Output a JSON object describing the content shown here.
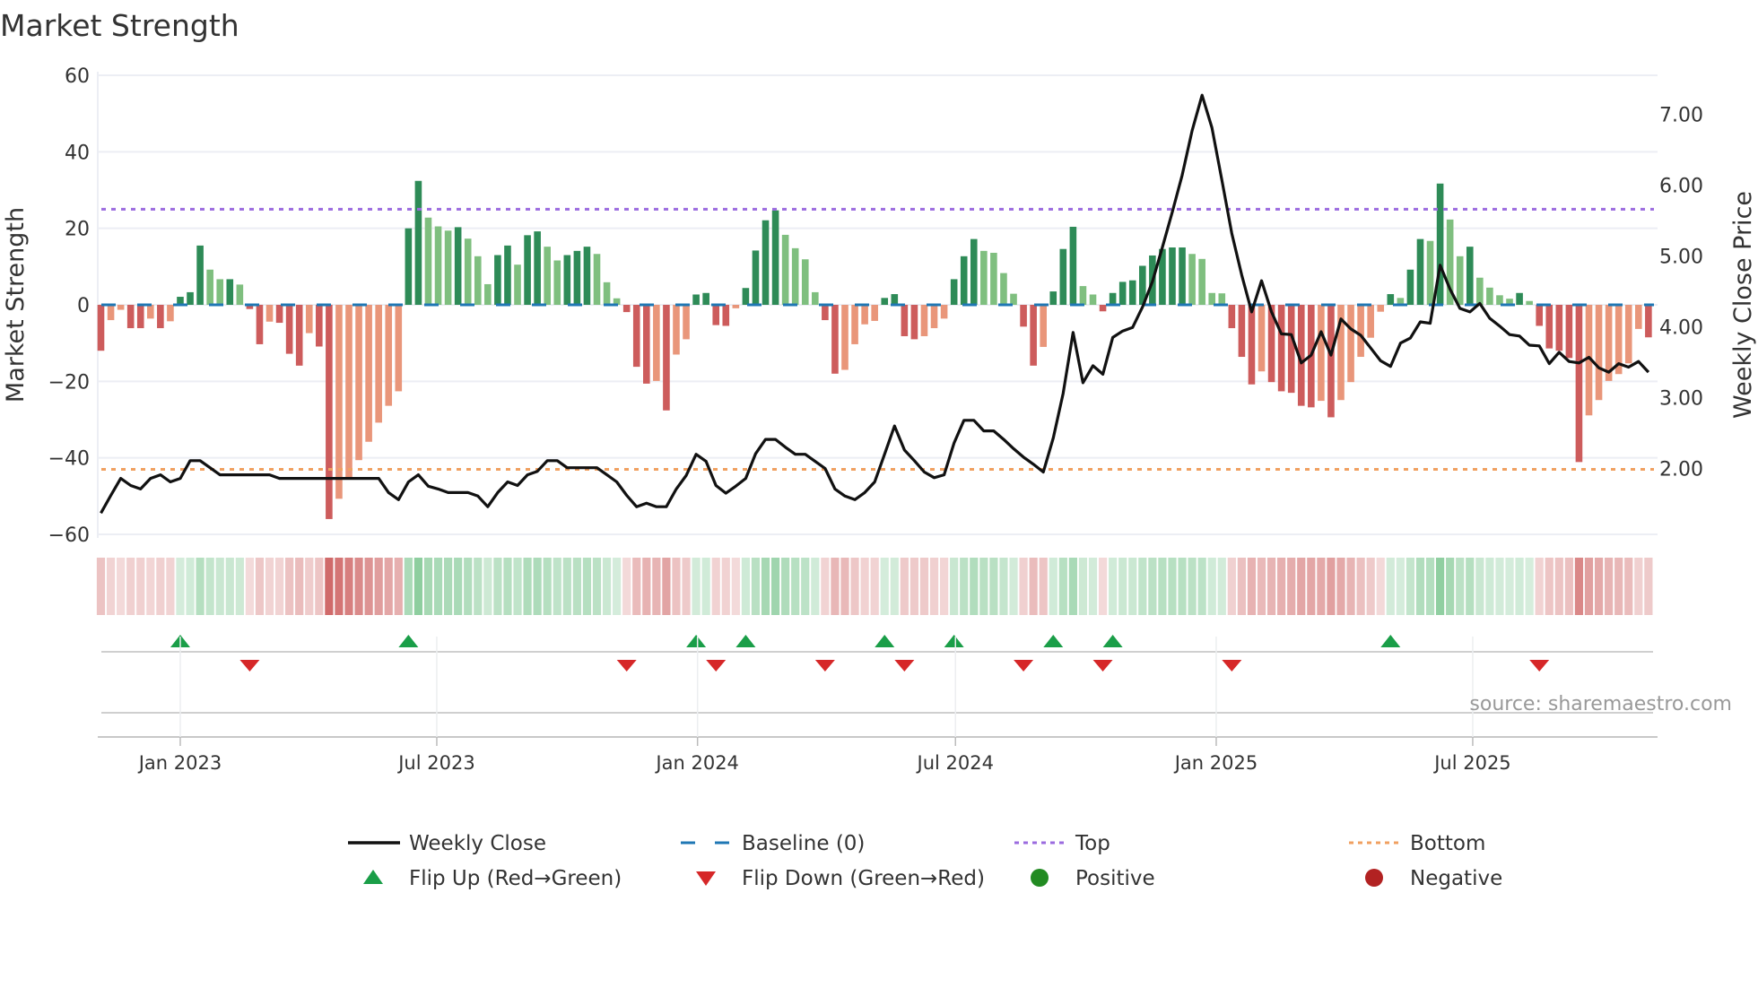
{
  "chart_data": {
    "type": "bar",
    "title": "Market Strength",
    "ylabel": "Market Strength",
    "y2label": "Weekly Close Price",
    "ylim": [
      -60,
      60
    ],
    "y2lim": [
      1.07,
      7.55
    ],
    "y_ticks": [
      60,
      40,
      20,
      0,
      -20,
      -40,
      -60
    ],
    "y_tick_labels": [
      "60",
      "40",
      "20",
      "0",
      "−20",
      "−40",
      "−60"
    ],
    "y2_ticks": [
      2,
      3,
      4,
      5,
      6,
      7
    ],
    "y2_tick_labels": [
      "2.00",
      "3.00",
      "4.00",
      "5.00",
      "6.00",
      "7.00"
    ],
    "x_start": "2022-11-06",
    "x_frequency": "weekly",
    "x_ticks": [
      {
        "date": "2023-01-01",
        "label": "Jan 2023"
      },
      {
        "date": "2023-07-01",
        "label": "Jul 2023"
      },
      {
        "date": "2024-01-01",
        "label": "Jan 2024"
      },
      {
        "date": "2024-07-01",
        "label": "Jul 2024"
      },
      {
        "date": "2025-01-01",
        "label": "Jan 2025"
      },
      {
        "date": "2025-07-01",
        "label": "Jul 2025"
      }
    ],
    "top_level": 25,
    "bottom_level": -43,
    "baseline": 0,
    "grid": true,
    "legend_placement": "bottom",
    "source": "source: sharemaestro.com",
    "series": [
      {
        "name": "Market Strength",
        "type": "bar",
        "values": [
          -12,
          -4,
          -1.3,
          -6.1,
          -6.1,
          -3.6,
          -6.1,
          -4.3,
          2.1,
          3.3,
          15.5,
          9.2,
          6.7,
          6.7,
          5.3,
          -1.1,
          -10.3,
          -4.4,
          -4.7,
          -12.8,
          -15.9,
          -7.4,
          -10.9,
          -56,
          -50.7,
          -45.4,
          -40.6,
          -35.8,
          -30.8,
          -26.4,
          -22.6,
          20,
          32.4,
          22.8,
          20.5,
          19.4,
          20.3,
          17.3,
          12.7,
          5.4,
          13,
          15.5,
          10.5,
          18.2,
          19.2,
          15.2,
          11.6,
          13,
          14.1,
          15.2,
          13.3,
          5.9,
          1.7,
          -1.9,
          -16.2,
          -20.6,
          -19.9,
          -27.6,
          -13,
          -9,
          2.7,
          3.1,
          -5.3,
          -5.5,
          -0.9,
          4.4,
          14.2,
          22.1,
          24.7,
          18.3,
          14.8,
          11.9,
          3.3,
          -4,
          -18,
          -17,
          -10.3,
          -5.1,
          -4.2,
          1.8,
          2.8,
          -8.2,
          -9,
          -8.2,
          -6.1,
          -3.6,
          6.7,
          12.7,
          17.2,
          14.1,
          13.6,
          8.3,
          2.9,
          -5.7,
          -15.9,
          -11,
          3.5,
          14.6,
          20.4,
          4.9,
          2.7,
          -1.7,
          3.1,
          6,
          6.4,
          10.2,
          12.9,
          14.6,
          15,
          15,
          13.3,
          12,
          3.1,
          3.0,
          -6.1,
          -13.6,
          -20.8,
          -17.4,
          -20.2,
          -22.6,
          -23,
          -26.4,
          -26.8,
          -25.1,
          -29.4,
          -24.9,
          -20.2,
          -13.6,
          -8.6,
          -1.8,
          2.8,
          1.8,
          9.2,
          17.2,
          16.7,
          31.7,
          22.3,
          12.7,
          15.2,
          7.1,
          4.5,
          2.5,
          1.6,
          3.1,
          1,
          -5.5,
          -11.4,
          -12,
          -13.9,
          -41.1,
          -28.9,
          -24.9,
          -19.9,
          -18.1,
          -15.3,
          -6.3,
          -8.5
        ]
      },
      {
        "name": "Weekly Close",
        "type": "line",
        "axis": "right",
        "values": [
          1.37,
          1.62,
          1.86,
          1.76,
          1.71,
          1.86,
          1.91,
          1.81,
          1.86,
          2.11,
          2.11,
          2.01,
          1.91,
          1.91,
          1.91,
          1.91,
          1.91,
          1.91,
          1.86,
          1.86,
          1.86,
          1.86,
          1.86,
          1.86,
          1.86,
          1.86,
          1.86,
          1.86,
          1.86,
          1.66,
          1.56,
          1.81,
          1.91,
          1.75,
          1.71,
          1.66,
          1.66,
          1.66,
          1.61,
          1.46,
          1.66,
          1.81,
          1.76,
          1.91,
          1.96,
          2.11,
          2.11,
          2.01,
          2.01,
          2.01,
          2.01,
          1.91,
          1.81,
          1.62,
          1.46,
          1.51,
          1.46,
          1.46,
          1.71,
          1.9,
          2.2,
          2.1,
          1.76,
          1.65,
          1.75,
          1.86,
          2.21,
          2.41,
          2.41,
          2.3,
          2.2,
          2.2,
          2.1,
          2.0,
          1.71,
          1.61,
          1.56,
          1.66,
          1.81,
          2.2,
          2.6,
          2.26,
          2.11,
          1.95,
          1.87,
          1.91,
          2.36,
          2.68,
          2.68,
          2.53,
          2.53,
          2.41,
          2.28,
          2.16,
          2.06,
          1.95,
          2.43,
          3.06,
          3.92,
          3.21,
          3.45,
          3.33,
          3.85,
          3.94,
          3.99,
          4.28,
          4.64,
          5.12,
          5.62,
          6.14,
          6.77,
          7.27,
          6.81,
          6.07,
          5.32,
          4.73,
          4.21,
          4.65,
          4.21,
          3.9,
          3.89,
          3.49,
          3.6,
          3.93,
          3.6,
          4.11,
          3.97,
          3.88,
          3.7,
          3.52,
          3.44,
          3.77,
          3.84,
          4.07,
          4.05,
          4.87,
          4.53,
          4.26,
          4.21,
          4.33,
          4.12,
          4.01,
          3.89,
          3.87,
          3.74,
          3.73,
          3.48,
          3.64,
          3.51,
          3.49,
          3.57,
          3.42,
          3.36,
          3.48,
          3.43,
          3.51,
          3.36
        ]
      }
    ],
    "legend": [
      {
        "label": "Weekly Close",
        "symbol": "line"
      },
      {
        "label": "Baseline (0)",
        "symbol": "dashed-line"
      },
      {
        "label": "Top",
        "symbol": "dotted-line"
      },
      {
        "label": "Bottom",
        "symbol": "dotted-line"
      },
      {
        "label": "Flip Up (Red→Green)",
        "symbol": "triangle-up"
      },
      {
        "label": "Flip Down (Green→Red)",
        "symbol": "triangle-down"
      },
      {
        "label": "Positive",
        "symbol": "circle"
      },
      {
        "label": "Negative",
        "symbol": "circle"
      }
    ]
  },
  "colors": {
    "pos_dark": "#2e8b57",
    "pos_light": "#7fbf7f",
    "neg_dark": "#cd5c5c",
    "neg_light": "#e9967a",
    "baseline": "#1f77b4",
    "top": "#9b6bdf",
    "bottom": "#f0a060",
    "close": "#111111",
    "flip_up": "#1a9e48",
    "flip_down": "#d62728",
    "positive": "#228b22",
    "negative": "#b22222",
    "grid": "#eceef4",
    "source": "#999999"
  }
}
